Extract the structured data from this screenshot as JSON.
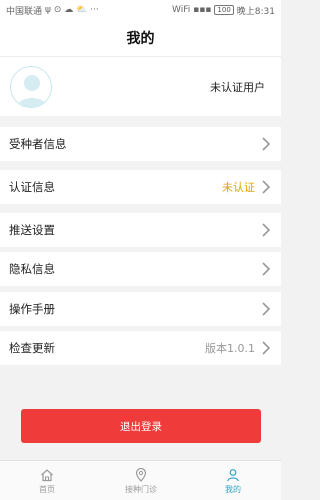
{
  "status_bar": {
    "carrier": "中国联通",
    "indicators": "ψ ⊙ ☁ ⛅ ···",
    "signal": "WiFi ▪▪▪",
    "battery": "100",
    "time": "晚上8:31"
  },
  "header": {
    "title": "我的"
  },
  "profile": {
    "name": "未认证用户"
  },
  "menu": [
    {
      "label": "受种者信息",
      "value": ""
    },
    {
      "label": "认证信息",
      "value": "未认证"
    },
    {
      "label": "推送设置",
      "value": ""
    },
    {
      "label": "隐私信息",
      "value": ""
    },
    {
      "label": "操作手册",
      "value": ""
    },
    {
      "label": "检查更新",
      "value": "版本1.0.1"
    }
  ],
  "logout_label": "退出登录",
  "tabs": [
    {
      "label": "首页"
    },
    {
      "label": "接种门诊"
    },
    {
      "label": "我的"
    }
  ],
  "colors": {
    "accent": "#2fa4c8",
    "danger": "#ef3b39",
    "warning": "#e6a100",
    "muted": "#999999"
  }
}
